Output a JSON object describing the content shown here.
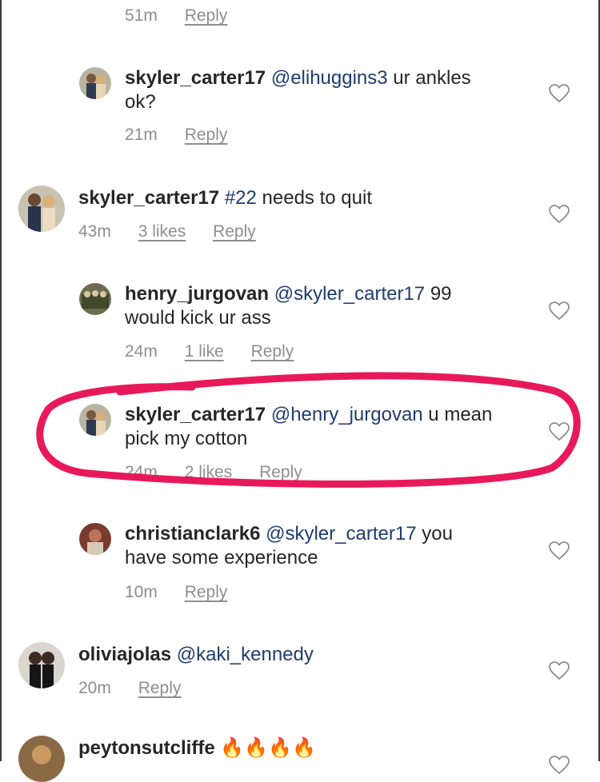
{
  "top_row": {
    "time": "51m",
    "reply": "Reply"
  },
  "comments": [
    {
      "username": "skyler_carter17",
      "mention": "@elihuggins3",
      "text_line1": " ur ankles",
      "text_line2": "ok?",
      "time": "21m",
      "likes": "",
      "reply": "Reply"
    },
    {
      "username": "skyler_carter17",
      "mention": "#22",
      "text_line1": " needs to quit",
      "text_line2": "",
      "time": "43m",
      "likes": "3 likes",
      "reply": "Reply"
    },
    {
      "username": "henry_jurgovan",
      "mention": "@skyler_carter17",
      "text_line1": " 99",
      "text_line2": "would kick ur ass",
      "time": "24m",
      "likes": "1 like",
      "reply": "Reply"
    },
    {
      "username": "skyler_carter17",
      "mention": "@henry_jurgovan",
      "text_line1": " u mean",
      "text_line2": "pick my cotton",
      "time": "24m",
      "likes": "2 likes",
      "reply": "Reply"
    },
    {
      "username": "christianclark6",
      "mention": "@skyler_carter17",
      "text_line1": " you",
      "text_line2": "have some experience",
      "time": "10m",
      "likes": "",
      "reply": "Reply"
    },
    {
      "username": "oliviajolas",
      "mention": "@kaki_kennedy",
      "text_line1": "",
      "text_line2": "",
      "time": "20m",
      "likes": "",
      "reply": "Reply"
    },
    {
      "username": "peytonsutcliffe",
      "mention": "",
      "text_line1": " 🔥🔥🔥🔥",
      "text_line2": "",
      "time": "",
      "likes": "",
      "reply": ""
    }
  ],
  "colors": {
    "highlight_circle": "#e8195a",
    "mention": "#1f3c6e",
    "meta_text": "#8e8e8e"
  },
  "icons": {
    "like": "heart-outline-icon"
  }
}
